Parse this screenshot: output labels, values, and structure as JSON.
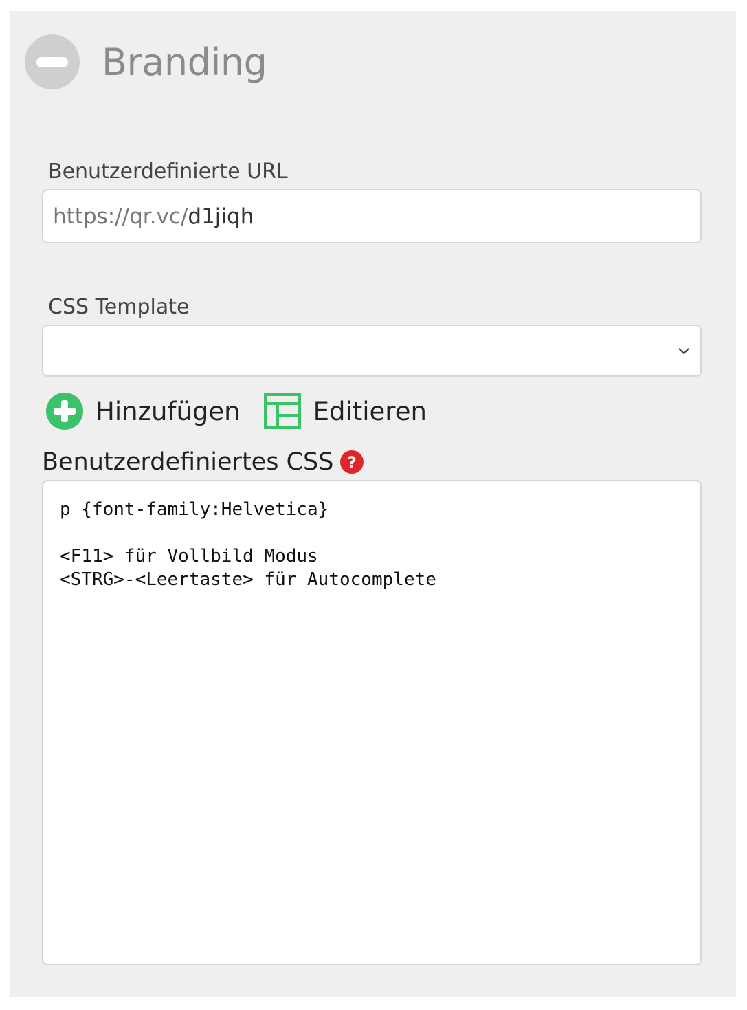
{
  "section": {
    "title": "Branding",
    "collapse_icon": "minus-circle-icon"
  },
  "custom_url": {
    "label": "Benutzerdefinierte URL",
    "prefix": "https://qr.vc/",
    "value": "d1jiqh"
  },
  "css_template": {
    "label": "CSS Template",
    "selected": ""
  },
  "actions": {
    "add_label": "Hinzufügen",
    "edit_label": "Editieren"
  },
  "custom_css": {
    "label": "Benutzerdefiniertes CSS",
    "lines": [
      "p {font-family:Helvetica}",
      "",
      "<F11> für Vollbild Modus",
      "<STRG>-<Leertaste> für Autocomplete"
    ]
  },
  "colors": {
    "panel_bg": "#efefef",
    "accent_green": "#3cc36a",
    "help_red": "#e0252b"
  }
}
